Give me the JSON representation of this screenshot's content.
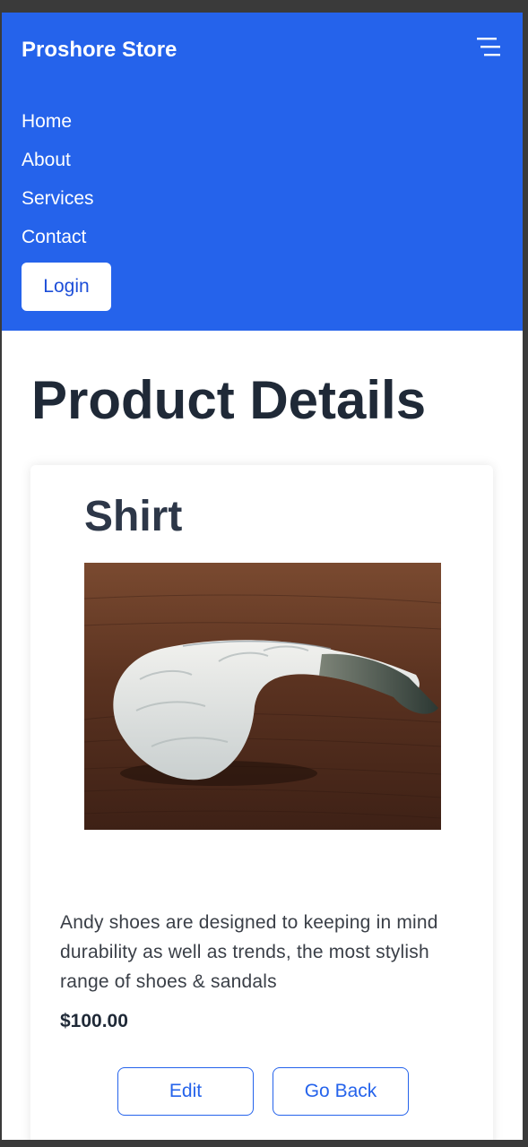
{
  "navbar": {
    "brand": "Proshore Store",
    "menu_icon": "hamburger-menu-icon",
    "links": [
      "Home",
      "About",
      "Services",
      "Contact"
    ],
    "login_label": "Login",
    "background_color": "#2563eb"
  },
  "page": {
    "title": "Product Details"
  },
  "product": {
    "name": "Shirt",
    "image_alt": "Raw shrimp on a wooden board",
    "description": "Andy shoes are designed to keeping in mind durability as well as trends, the most stylish range of shoes & sandals",
    "price": "$100.00"
  },
  "actions": {
    "edit_label": "Edit",
    "back_label": "Go Back",
    "accent_color": "#2563eb"
  }
}
